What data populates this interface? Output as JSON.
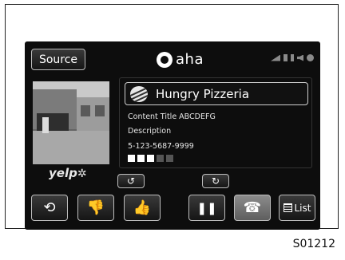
{
  "header": {
    "source_label": "Source",
    "brand": "aha"
  },
  "station": {
    "name": "Hungry Pizzeria"
  },
  "details": {
    "title": "Content Title ABCDEFG",
    "description": "Description",
    "phone": "5-123-5687-9999",
    "rating_dots": [
      true,
      true,
      true,
      false,
      false
    ]
  },
  "branding": {
    "yelp": "yelp"
  },
  "controls": {
    "replay_back": "↺",
    "replay_fwd": "↻",
    "refresh": "⟲",
    "dislike": "👎",
    "like": "👍",
    "pause": "❚❚",
    "call": "☎",
    "list_label": "List"
  },
  "caption": "S01212"
}
